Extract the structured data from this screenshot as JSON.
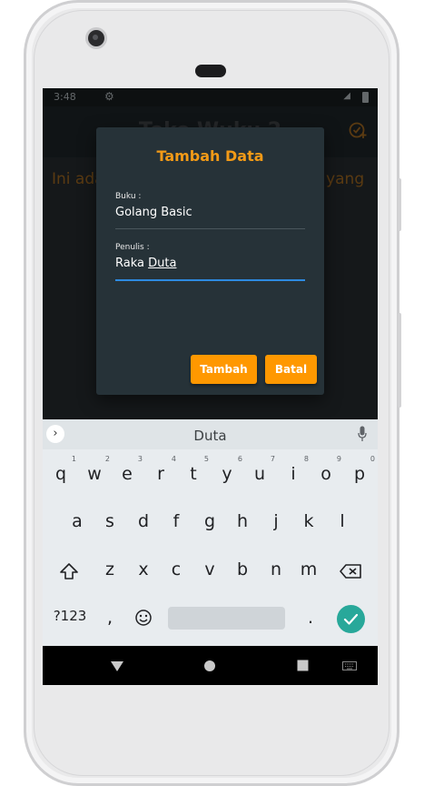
{
  "status_bar": {
    "time": "3:48"
  },
  "app_bar": {
    "title": "Toko Wuku 2"
  },
  "background_text": {
    "left": "Ini ada",
    "right": "t yang"
  },
  "dialog": {
    "title": "Tambah Data",
    "fields": [
      {
        "label": "Buku :",
        "value": "Golang Basic"
      },
      {
        "label": "Penulis :",
        "value_plain": "Raka ",
        "value_composing": "Duta"
      }
    ],
    "buttons": {
      "add": "Tambah",
      "cancel": "Batal"
    }
  },
  "keyboard": {
    "suggestion": "Duta",
    "row1": [
      "q",
      "w",
      "e",
      "r",
      "t",
      "y",
      "u",
      "i",
      "o",
      "p"
    ],
    "row1_hints": [
      "1",
      "2",
      "3",
      "4",
      "5",
      "6",
      "7",
      "8",
      "9",
      "0"
    ],
    "row2": [
      "a",
      "s",
      "d",
      "f",
      "g",
      "h",
      "j",
      "k",
      "l"
    ],
    "row3": [
      "z",
      "x",
      "c",
      "v",
      "b",
      "n",
      "m"
    ],
    "symbols_label": "?123",
    "comma": ",",
    "period": "."
  },
  "colors": {
    "accent": "#ff9800",
    "title_orange": "#f29a17",
    "focus_line": "#2d8ae0",
    "dialog_bg": "#263238",
    "enter_key": "#28a89a"
  }
}
